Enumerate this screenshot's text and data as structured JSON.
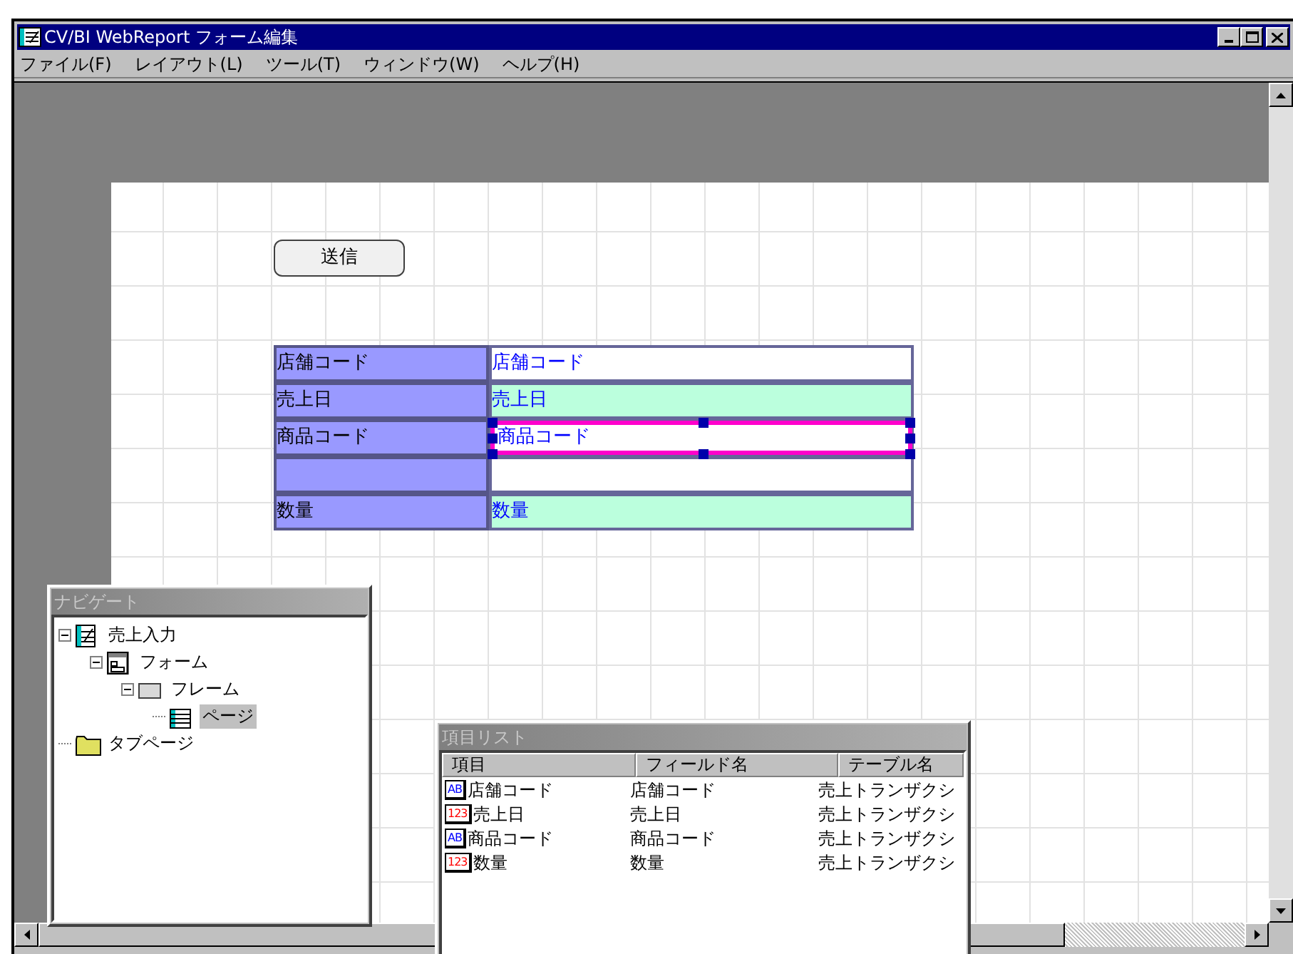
{
  "window": {
    "title": "CV/BI WebReport フォーム編集"
  },
  "menu": [
    {
      "label": "ファイル(F)"
    },
    {
      "label": "レイアウト(L)"
    },
    {
      "label": "ツール(T)"
    },
    {
      "label": "ウィンドウ(W)"
    },
    {
      "label": "ヘルプ(H)"
    }
  ],
  "form": {
    "button": "送信",
    "rows": [
      {
        "label": "店舗コード",
        "value": "店舗コード",
        "color": "#ffffff",
        "selected": false
      },
      {
        "label": "売上日",
        "value": "売上日",
        "color": "#bbffdd",
        "selected": false
      },
      {
        "label": "商品コード",
        "value": "商品コード",
        "color": "#ffffff",
        "selected": true
      },
      {
        "color": "#ffffff",
        "selected": false
      },
      {
        "label": "数量",
        "value": "数量",
        "color": "#bbffdd",
        "selected": false
      }
    ]
  },
  "navigator": {
    "title": "ナビゲート",
    "tree": [
      {
        "label": "売上入力",
        "kind": "report",
        "expanded": true,
        "selected": false,
        "children": [
          {
            "label": "フォーム",
            "kind": "form",
            "expanded": true,
            "selected": false,
            "children": [
              {
                "label": "フレーム",
                "kind": "frame",
                "expanded": true,
                "selected": false,
                "children": [
                  {
                    "label": "ページ",
                    "kind": "page",
                    "selected": true
                  }
                ]
              }
            ]
          }
        ]
      },
      {
        "label": "タブページ",
        "kind": "folder",
        "selected": false
      }
    ]
  },
  "item_list": {
    "title": "項目リスト",
    "columns": [
      "項目",
      "フィールド名",
      "テーブル名"
    ],
    "rows": [
      {
        "kind": "text",
        "badge": "AB",
        "item": "店舗コード",
        "field": "店舗コード",
        "table": "売上トランザクシ"
      },
      {
        "kind": "number",
        "badge": "123",
        "item": "売上日",
        "field": "売上日",
        "table": "売上トランザクシ"
      },
      {
        "kind": "text",
        "badge": "AB",
        "item": "商品コード",
        "field": "商品コード",
        "table": "売上トランザクシ"
      },
      {
        "kind": "number",
        "badge": "123",
        "item": "数量",
        "field": "数量",
        "table": "売上トランザクシ"
      }
    ]
  }
}
